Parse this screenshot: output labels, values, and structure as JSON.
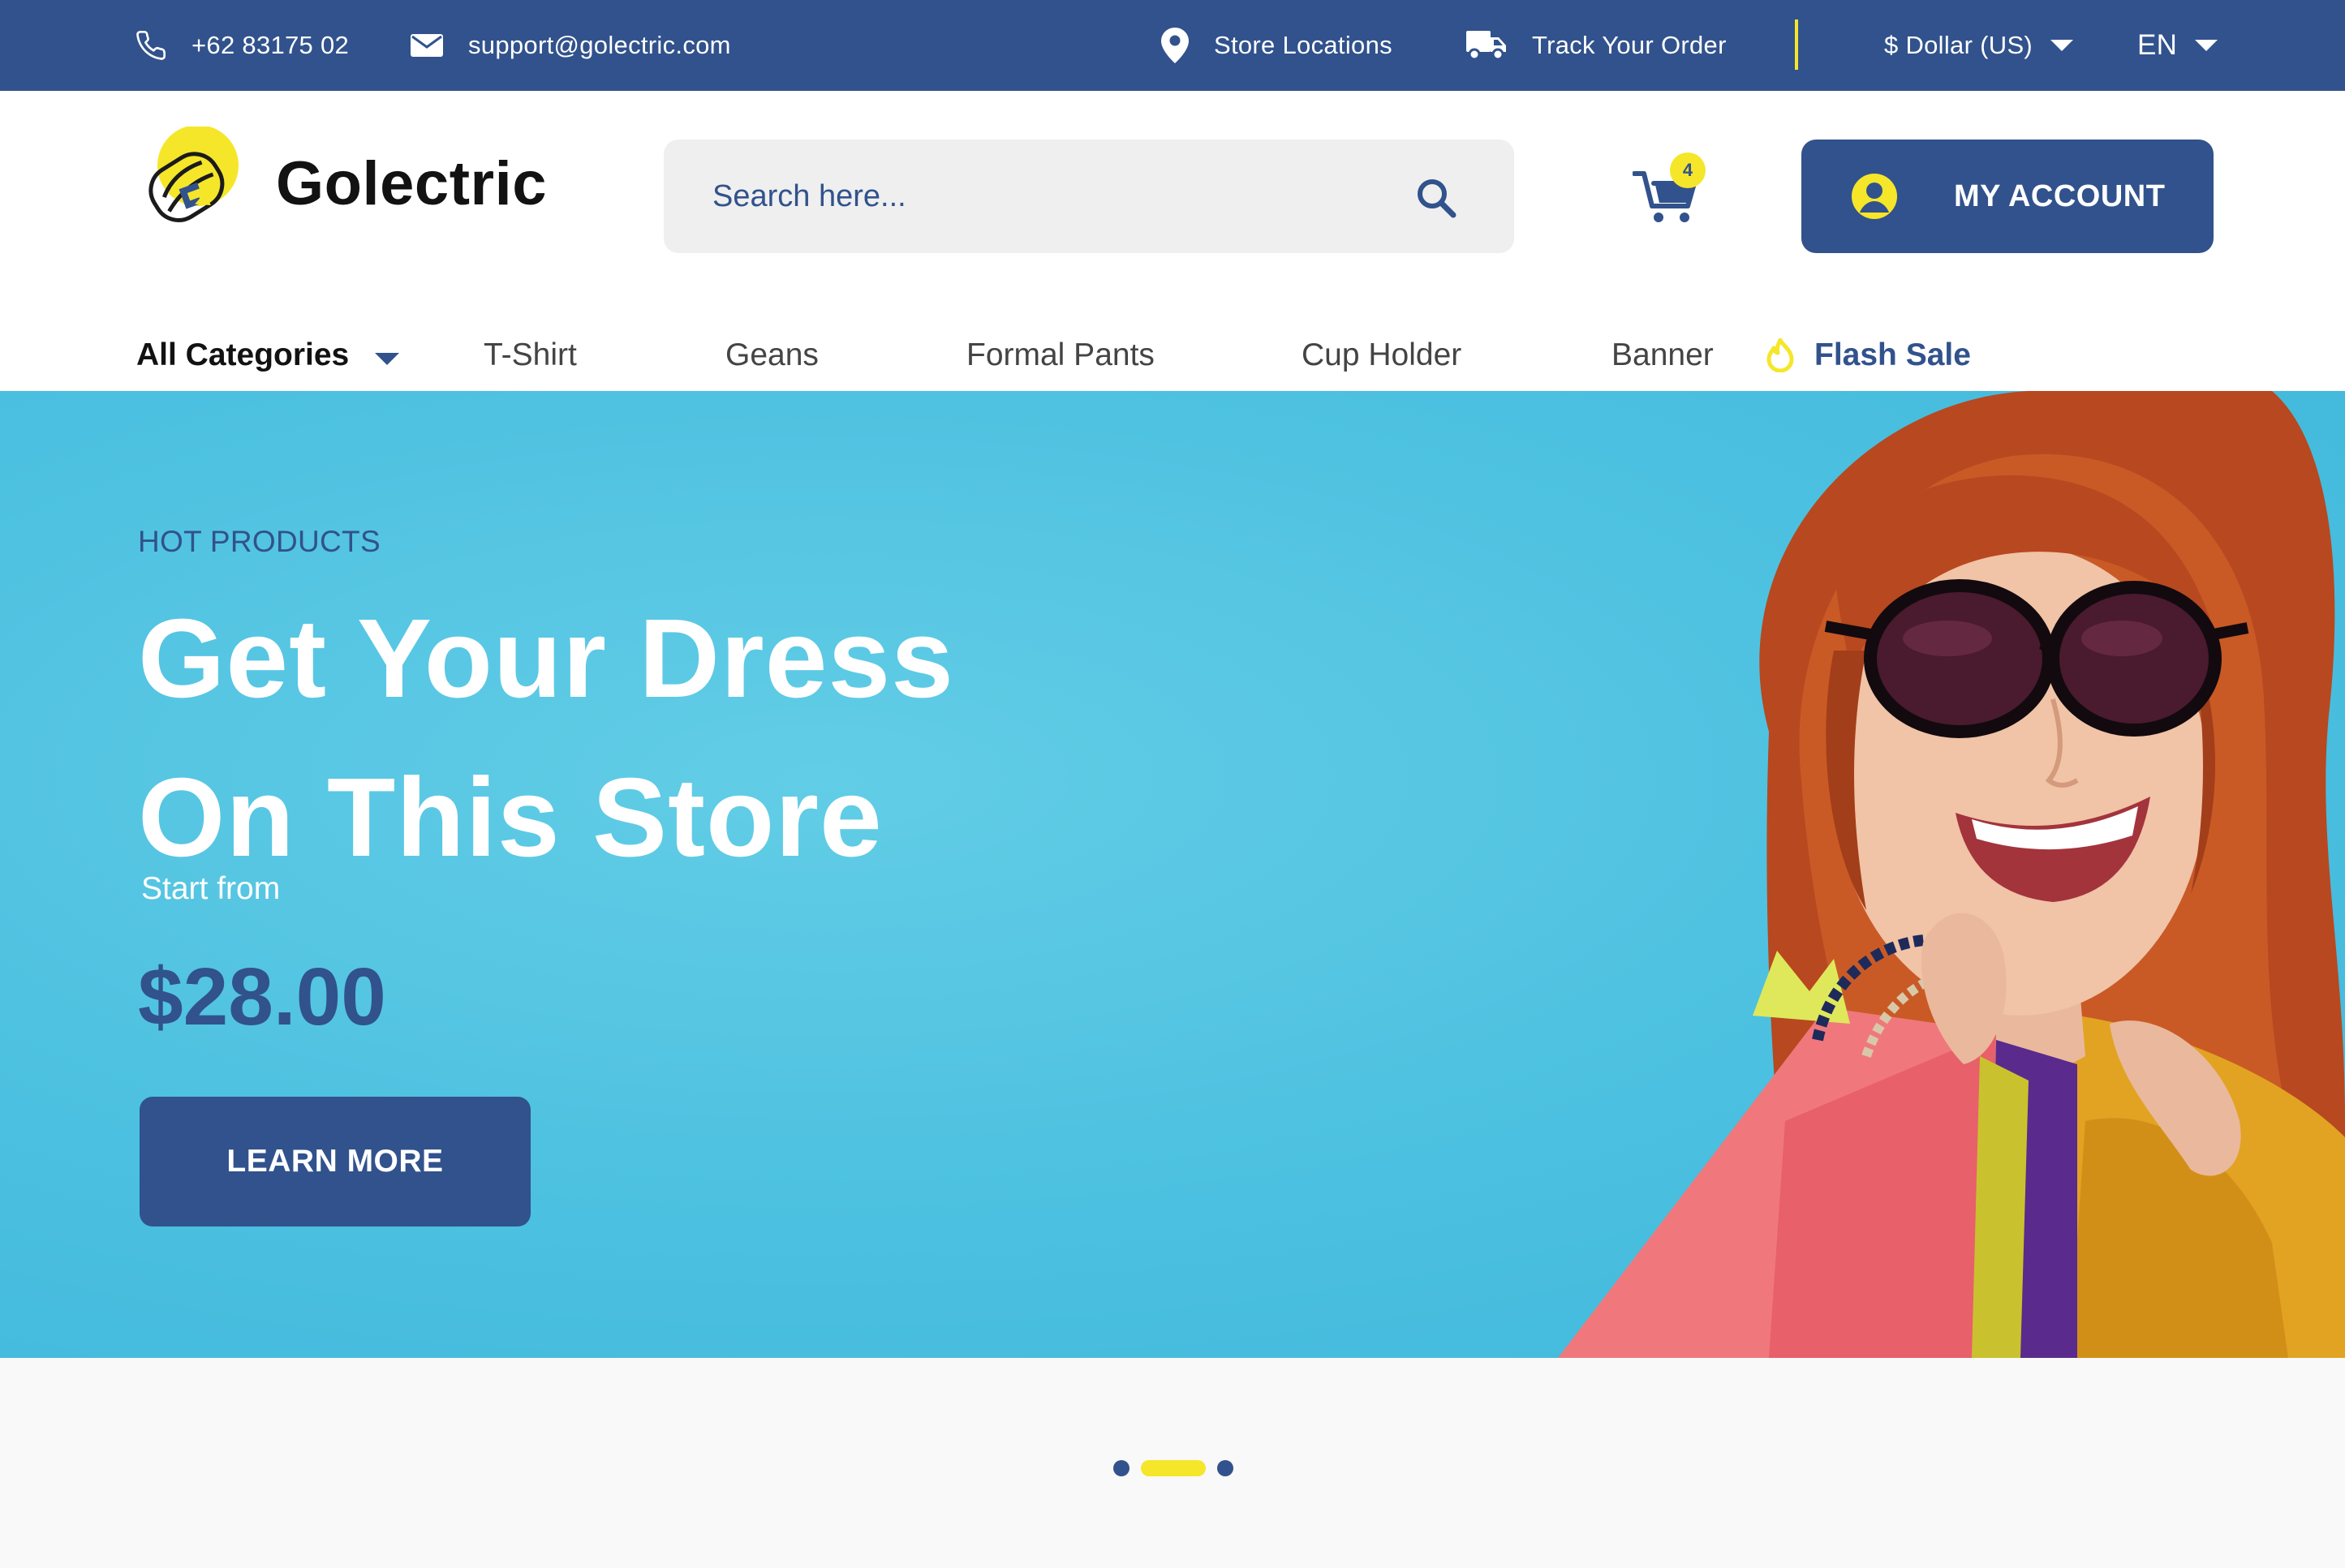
{
  "topbar": {
    "phone": "+62 83175 02",
    "email": "support@golectric.com",
    "store_locations": "Store Locations",
    "track_order": "Track Your Order",
    "currency": "$ Dollar (US)",
    "language": "EN"
  },
  "header": {
    "brand": "Golectric",
    "search_placeholder": "Search here...",
    "cart_count": "4",
    "account_label": "MY ACCOUNT"
  },
  "nav": {
    "all_categories": "All Categories",
    "items": [
      "T-Shirt",
      "Geans",
      "Formal Pants",
      "Cup Holder",
      "Banner"
    ],
    "flash_sale": "Flash Sale"
  },
  "hero": {
    "eyebrow": "HOT PRODUCTS",
    "headline_line1": "Get Your Dress",
    "headline_line2": "On This Store",
    "start_from": "Start from",
    "price": "$28.00",
    "cta": "LEARN MORE"
  },
  "carousel": {
    "slides": 3,
    "active_index": 1
  },
  "colors": {
    "primary": "#31528c",
    "accent": "#f5e62a",
    "hero_bg": "#4cc0e0",
    "white": "#ffffff"
  },
  "icons": [
    "phone-icon",
    "mail-icon",
    "map-pin-icon",
    "truck-icon",
    "search-icon",
    "cart-icon",
    "user-icon",
    "flame-icon",
    "chevron-down-icon"
  ]
}
